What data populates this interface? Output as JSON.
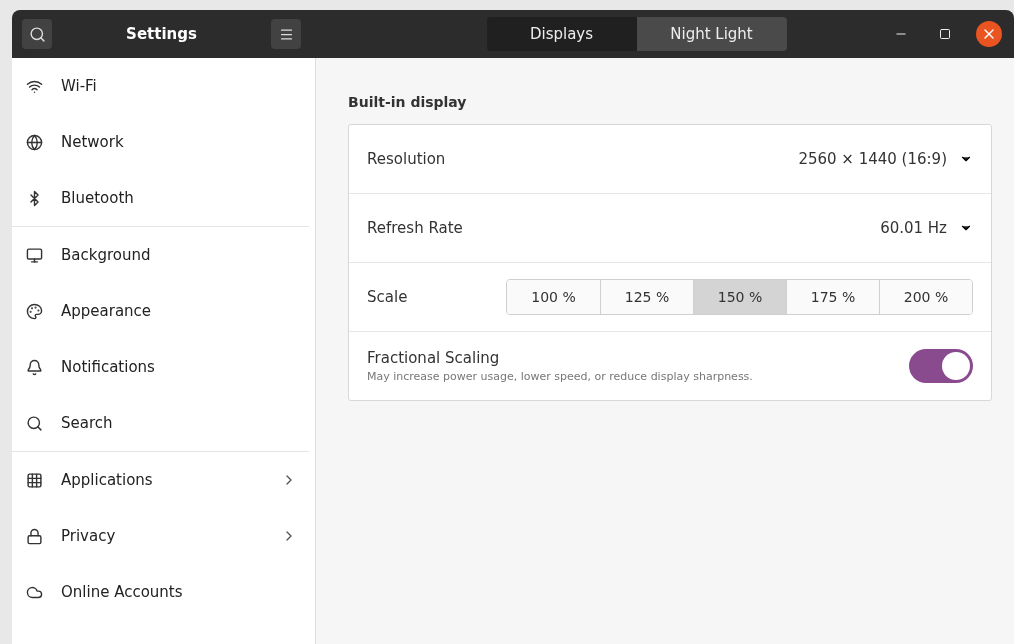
{
  "window": {
    "title": "Settings"
  },
  "tabs": [
    {
      "label": "Displays",
      "selected": true
    },
    {
      "label": "Night Light",
      "selected": false
    }
  ],
  "sidebar": {
    "groups": [
      [
        {
          "label": "Wi-Fi",
          "has_submenu": false
        },
        {
          "label": "Network",
          "has_submenu": false
        },
        {
          "label": "Bluetooth",
          "has_submenu": false
        }
      ],
      [
        {
          "label": "Background",
          "has_submenu": false
        },
        {
          "label": "Appearance",
          "has_submenu": false
        },
        {
          "label": "Notifications",
          "has_submenu": false
        },
        {
          "label": "Search",
          "has_submenu": false
        }
      ],
      [
        {
          "label": "Applications",
          "has_submenu": true
        },
        {
          "label": "Privacy",
          "has_submenu": true
        },
        {
          "label": "Online Accounts",
          "has_submenu": false
        }
      ]
    ]
  },
  "display": {
    "heading": "Built-in display",
    "resolution": {
      "label": "Resolution",
      "value": "2560 × 1440 (16:9)"
    },
    "refresh_rate": {
      "label": "Refresh Rate",
      "value": "60.01 Hz"
    },
    "scale": {
      "label": "Scale",
      "options": [
        {
          "label": "100 %",
          "selected": false
        },
        {
          "label": "125 %",
          "selected": false
        },
        {
          "label": "150 %",
          "selected": true
        },
        {
          "label": "175 %",
          "selected": false
        },
        {
          "label": "200 %",
          "selected": false
        }
      ]
    },
    "fractional_scaling": {
      "label": "Fractional Scaling",
      "description": "May increase power usage, lower speed, or reduce display sharpness.",
      "on": true
    }
  }
}
